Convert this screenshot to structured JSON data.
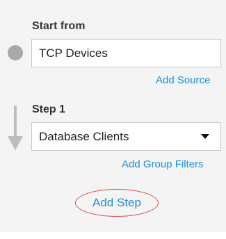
{
  "start": {
    "label": "Start from",
    "source_value": "TCP Devices",
    "add_source_label": "Add Source"
  },
  "step1": {
    "label": "Step 1",
    "selected_option": "Database Clients",
    "add_group_filters_label": "Add Group Filters"
  },
  "add_step_label": "Add Step",
  "colors": {
    "link": "#1f8fd6",
    "highlight_ring": "#e0494a",
    "panel_bg": "#f4f4f4",
    "marker": "#a9a9a9"
  }
}
